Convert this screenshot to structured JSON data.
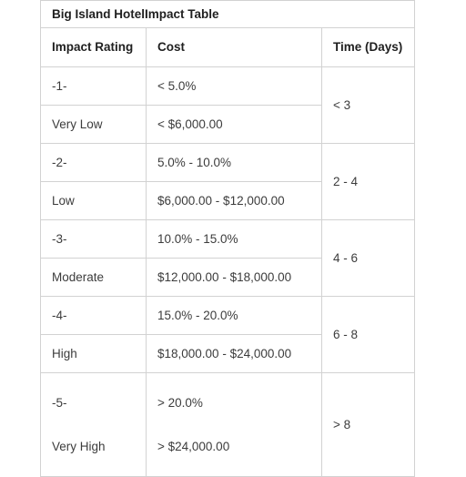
{
  "table": {
    "title": "Big Island HotelImpact Table",
    "columns": [
      {
        "key": "impact_rating",
        "label": "Impact Rating"
      },
      {
        "key": "cost",
        "label": "Cost"
      },
      {
        "key": "time_days",
        "label": "Time (Days)"
      }
    ],
    "rows": [
      {
        "impact_rating": "-1-",
        "cost": "< 5.0%"
      },
      {
        "impact_rating": "Very Low",
        "cost": "< $6,000.00"
      },
      {
        "impact_rating": "-2-",
        "cost": "5.0% - 10.0%"
      },
      {
        "impact_rating": "Low",
        "cost": "$6,000.00 - $12,000.00"
      },
      {
        "impact_rating": "-3-",
        "cost": "10.0% - 15.0%"
      },
      {
        "impact_rating": "Moderate",
        "cost": "$12,000.00 - $18,000.00"
      },
      {
        "impact_rating": "-4-",
        "cost": "15.0% - 20.0%"
      },
      {
        "impact_rating": "High",
        "cost": "$18,000.00 - $24,000.00"
      }
    ],
    "final_block": {
      "impact_rating_line1": "-5-",
      "impact_rating_line2": "Very High",
      "cost_line1": "> 20.0%",
      "cost_line2": "> $24,000.00",
      "time_days": "> 8"
    },
    "time_spans": [
      {
        "label": "< 3"
      },
      {
        "label": "2 - 4"
      },
      {
        "label": "4 - 6"
      },
      {
        "label": "6 - 8"
      }
    ]
  },
  "colors": {
    "border": "#d2d2d2",
    "heading_text": "#1f1f1f",
    "body_text": "#3c3c3c",
    "background": "#ffffff"
  }
}
